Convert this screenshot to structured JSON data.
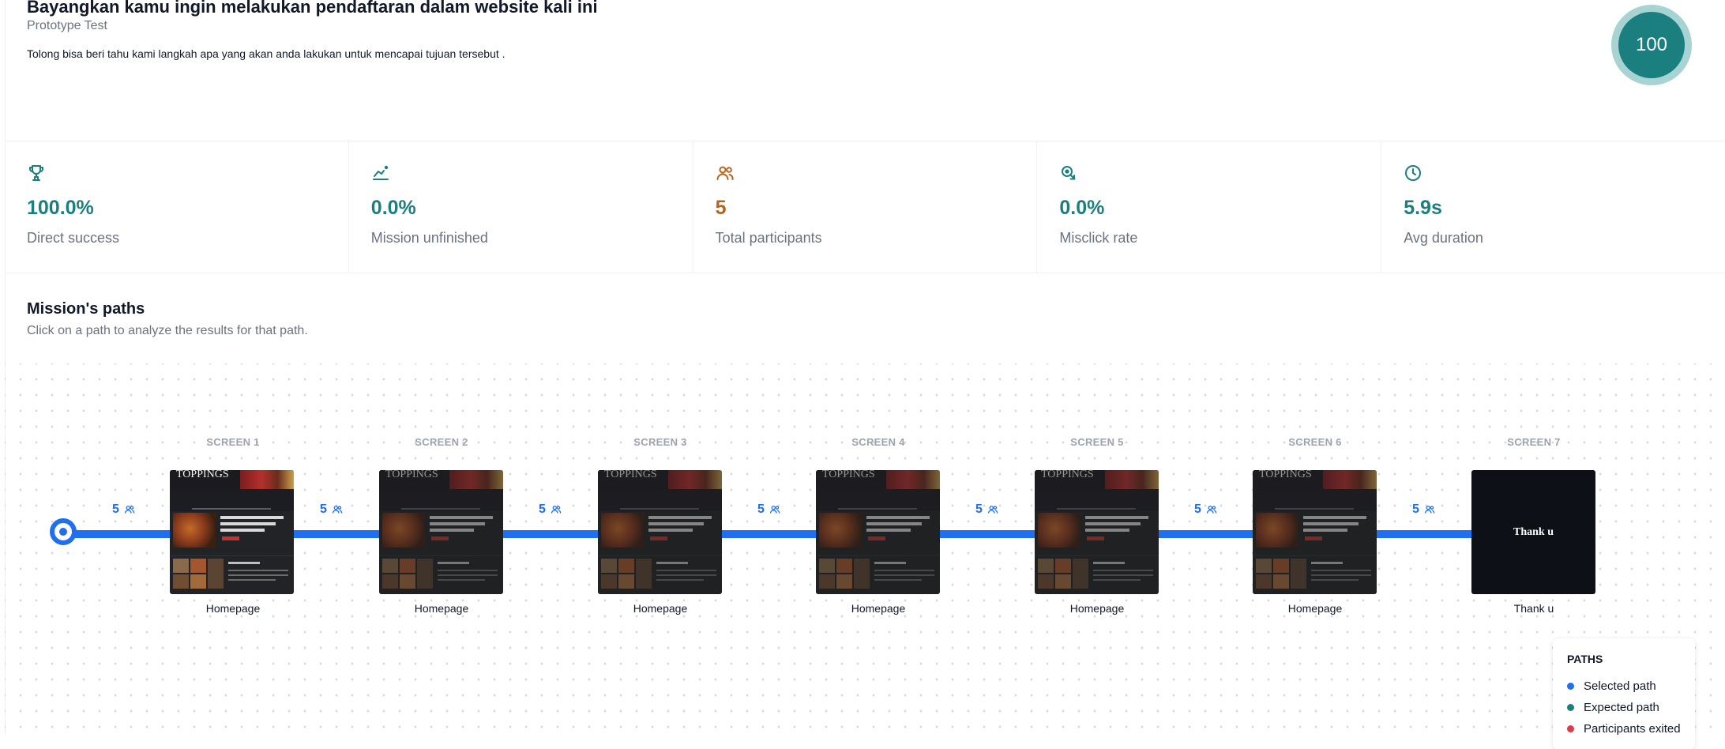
{
  "mission": {
    "title": "Bayangkan kamu ingin melakukan pendaftaran dalam website kali ini",
    "subtitle": "Prototype Test",
    "description": "Tolong bisa beri tahu kami langkah apa yang akan anda lakukan untuk mencapai tujuan tersebut .",
    "score": "100"
  },
  "stats": [
    {
      "value": "100.0%",
      "label": "Direct success",
      "icon": "trophy-icon",
      "color": "#1a7f7e"
    },
    {
      "value": "0.0%",
      "label": "Mission unfinished",
      "icon": "unfinished-icon",
      "color": "#1a7f7e"
    },
    {
      "value": "5",
      "label": "Total participants",
      "icon": "participants-icon",
      "color": "#b5651d"
    },
    {
      "value": "0.0%",
      "label": "Misclick rate",
      "icon": "misclick-icon",
      "color": "#1a7f7e"
    },
    {
      "value": "5.9s",
      "label": "Avg duration",
      "icon": "clock-icon",
      "color": "#1a7f7e"
    }
  ],
  "paths": {
    "title": "Mission's paths",
    "subtitle": "Click on a path to analyze the results for that path.",
    "edge_count": "5",
    "screens": [
      {
        "label": "SCREEN 1",
        "caption": "Homepage",
        "thumb_title": "TOPPINGS"
      },
      {
        "label": "SCREEN 2",
        "caption": "Homepage",
        "thumb_title": "TOPPINGS"
      },
      {
        "label": "SCREEN 3",
        "caption": "Homepage",
        "thumb_title": "TOPPINGS"
      },
      {
        "label": "SCREEN 4",
        "caption": "Homepage",
        "thumb_title": "TOPPINGS"
      },
      {
        "label": "SCREEN 5",
        "caption": "Homepage",
        "thumb_title": "TOPPINGS"
      },
      {
        "label": "SCREEN 6",
        "caption": "Homepage",
        "thumb_title": "TOPPINGS"
      },
      {
        "label": "SCREEN 7",
        "caption": "Thank u",
        "thumb_title": "Thank u"
      }
    ]
  },
  "legend": {
    "title": "PATHS",
    "items": [
      {
        "label": "Selected path",
        "color": "#1f6ff0"
      },
      {
        "label": "Expected path",
        "color": "#1a7f7e"
      },
      {
        "label": "Participants exited",
        "color": "#e0394b"
      }
    ]
  }
}
